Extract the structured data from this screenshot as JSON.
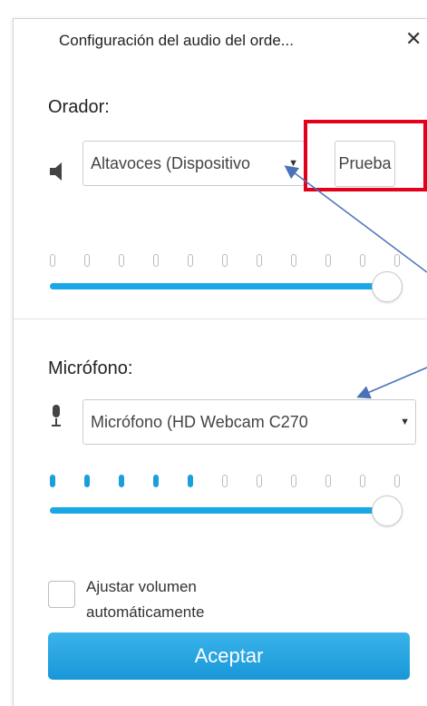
{
  "dialog": {
    "title": "Configuración del audio del orde...",
    "close_label": "✕"
  },
  "speaker": {
    "label": "Orador:",
    "device": "Altavoces (Dispositivo",
    "test_button": "Prueba",
    "level_dots_total": 11,
    "level_dots_active": 0,
    "volume_percent": 100
  },
  "microphone": {
    "label": "Micrófono:",
    "device": "Micrófono (HD Webcam C270",
    "level_dots_total": 11,
    "level_dots_active": 5,
    "volume_percent": 100
  },
  "auto_adjust": {
    "label_line1": "Ajustar volumen",
    "label_line2": "automáticamente",
    "checked": false
  },
  "accept_button": "Aceptar",
  "annotation_color": "#e3001b",
  "accent_color": "#1aa7e6",
  "icons": {
    "speaker": "speaker-icon",
    "microphone": "microphone-icon",
    "dropdown": "caret-down-icon"
  }
}
